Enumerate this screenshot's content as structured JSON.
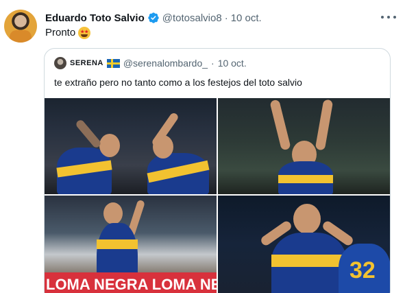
{
  "tweet": {
    "author_name": "Eduardo Toto Salvio",
    "handle": "@totosalvio8",
    "separator": "·",
    "date": "10 oct.",
    "text": "Pronto",
    "emoji_icon": "star-struck-emoji-icon",
    "verified_icon": "verified-badge-icon",
    "verified_color": "#1d9bf0"
  },
  "quoted": {
    "author_name": "SERENA",
    "flag_icon": "sweden-flag-icon",
    "handle": "@serenalombardo_",
    "separator": "·",
    "date": "10 oct.",
    "text": "te extraño pero no tanto como a los festejos del toto salvio"
  },
  "photos": {
    "banner_text": "LOMA NEGRA  LOMA NEG",
    "jersey_number": "32"
  },
  "colors": {
    "accent_blue": "#1d9bf0",
    "text_primary": "#0f1419",
    "text_secondary": "#536471",
    "border": "#cfd9de"
  }
}
